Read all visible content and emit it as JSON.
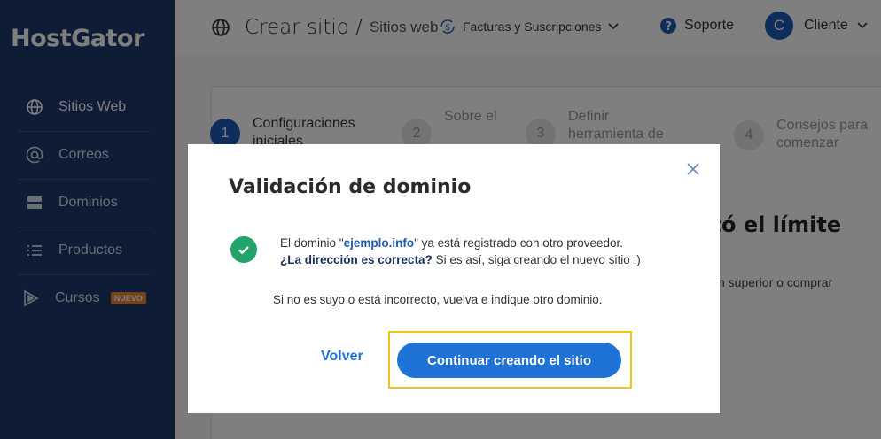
{
  "sidebar": {
    "logo": "HostGator",
    "items": [
      {
        "label": "Sitios Web",
        "icon": "globe-icon"
      },
      {
        "label": "Correos",
        "icon": "at-icon"
      },
      {
        "label": "Dominios",
        "icon": "server-icon"
      },
      {
        "label": "Productos",
        "icon": "list-icon"
      },
      {
        "label": "Cursos",
        "icon": "play-icon",
        "badge": "NUEVO"
      }
    ]
  },
  "topbar": {
    "breadcrumb_main": "Crear sitio /",
    "breadcrumb_sub": "Sitios web",
    "billing": "Facturas y Suscripciones",
    "support": "Soporte",
    "avatar_letter": "C",
    "user": "Cliente"
  },
  "steps": [
    {
      "num": "1",
      "label": "Configuraciones iniciales"
    },
    {
      "num": "2",
      "label": "Sobre el"
    },
    {
      "num": "3",
      "label": "Definir herramienta de"
    },
    {
      "num": "4",
      "label": "Consejos para comenzar"
    }
  ],
  "background": {
    "heading": "zó el límite",
    "text": "n superior o comprar"
  },
  "modal": {
    "title": "Validación de dominio",
    "line1_pre": "El dominio \"",
    "domain": "ejemplo.info",
    "line1_post": "\" ya está registrado con otro proveedor.",
    "line2_bold": "¿La dirección es correcta?",
    "line2_rest": " Si es así, siga creando el nuevo sitio :)",
    "line3": "Si no es suyo o está incorrecto, vuelva e indique otro dominio.",
    "back_label": "Volver",
    "continue_label": "Continuar creando el sitio"
  },
  "colors": {
    "sidebar": "#1d3a6b",
    "primary": "#1f73d6",
    "success": "#21a36a",
    "highlight": "#f0c419"
  }
}
